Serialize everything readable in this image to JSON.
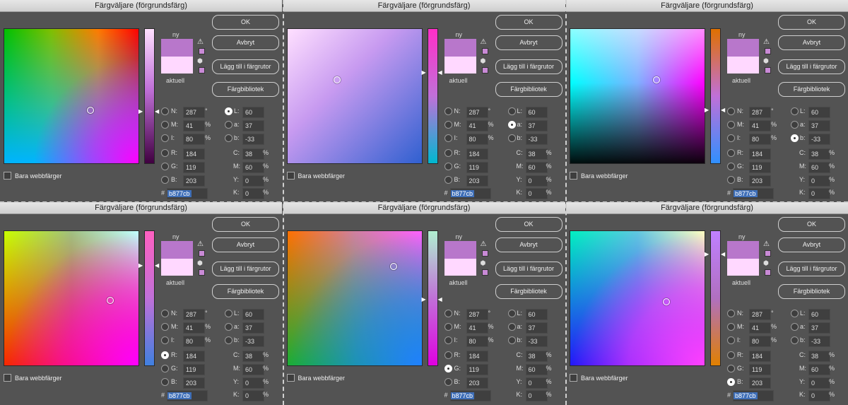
{
  "title": "Färgväljare (förgrundsfärg)",
  "labels": {
    "new": "ny",
    "current": "aktuell",
    "web_only": "Bara webbfärger",
    "hash": "#"
  },
  "buttons": {
    "ok": "OK",
    "cancel": "Avbryt",
    "add_swatches": "Lägg till i färgrutor",
    "libraries": "Färgbibliotek"
  },
  "fields": {
    "N": {
      "label": "N:",
      "value": "287",
      "unit": "°"
    },
    "M": {
      "label": "M:",
      "value": "41",
      "unit": "%"
    },
    "I": {
      "label": "I:",
      "value": "80",
      "unit": "%"
    },
    "R": {
      "label": "R:",
      "value": "184",
      "unit": ""
    },
    "G": {
      "label": "G:",
      "value": "119",
      "unit": ""
    },
    "B": {
      "label": "B:",
      "value": "203",
      "unit": ""
    },
    "L": {
      "label": "L:",
      "value": "60",
      "unit": ""
    },
    "a": {
      "label": "a:",
      "value": "37",
      "unit": ""
    },
    "b": {
      "label": "b:",
      "value": "-33",
      "unit": ""
    },
    "C": {
      "label": "C:",
      "value": "38",
      "unit": "%"
    },
    "M2": {
      "label": "M:",
      "value": "60",
      "unit": "%"
    },
    "Y": {
      "label": "Y:",
      "value": "0",
      "unit": "%"
    },
    "K": {
      "label": "K:",
      "value": "0",
      "unit": "%"
    },
    "hex": "b877cb"
  },
  "panels": [
    {
      "selected": "L"
    },
    {
      "selected": "a"
    },
    {
      "selected": "b"
    },
    {
      "selected": "R"
    },
    {
      "selected": "G"
    },
    {
      "selected": "B"
    }
  ],
  "colors": {
    "new_color": "#b877cb",
    "current_color": "#ffd8ff"
  }
}
